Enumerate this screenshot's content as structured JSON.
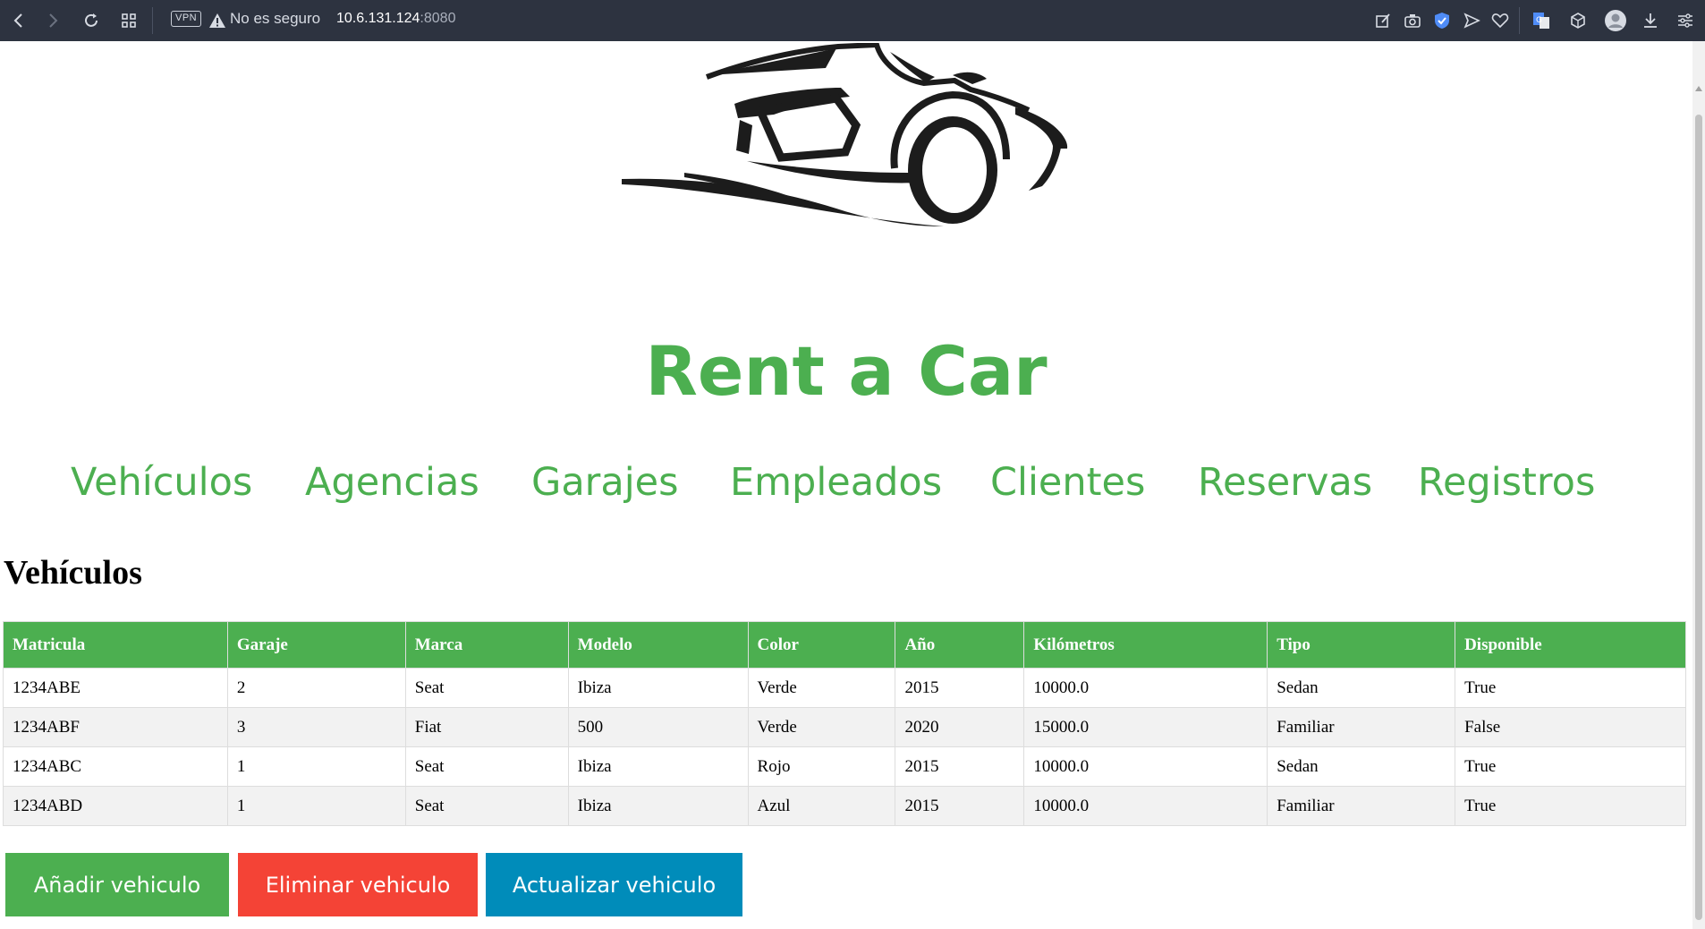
{
  "browser": {
    "vpn_label": "VPN",
    "security_text": "No es seguro",
    "url_host": "10.6.131.124",
    "url_port": ":8080"
  },
  "site": {
    "title": "Rent a Car"
  },
  "nav": {
    "items": [
      "Vehículos",
      "Agencias",
      "Garajes",
      "Empleados",
      "Clientes",
      "Reservas",
      "Registros"
    ]
  },
  "section": {
    "title": "Vehículos"
  },
  "table": {
    "headers": [
      "Matricula",
      "Garaje",
      "Marca",
      "Modelo",
      "Color",
      "Año",
      "Kilómetros",
      "Tipo",
      "Disponible"
    ],
    "rows": [
      [
        "1234ABE",
        "2",
        "Seat",
        "Ibiza",
        "Verde",
        "2015",
        "10000.0",
        "Sedan",
        "True"
      ],
      [
        "1234ABF",
        "3",
        "Fiat",
        "500",
        "Verde",
        "2020",
        "15000.0",
        "Familiar",
        "False"
      ],
      [
        "1234ABC",
        "1",
        "Seat",
        "Ibiza",
        "Rojo",
        "2015",
        "10000.0",
        "Sedan",
        "True"
      ],
      [
        "1234ABD",
        "1",
        "Seat",
        "Ibiza",
        "Azul",
        "2015",
        "10000.0",
        "Familiar",
        "True"
      ]
    ]
  },
  "actions": {
    "add_label": "Añadir vehiculo",
    "delete_label": "Eliminar vehiculo",
    "update_label": "Actualizar vehiculo"
  },
  "colors": {
    "accent_green": "#4caf50",
    "delete_red": "#f44336",
    "update_blue": "#008cba",
    "chrome_bg": "#2d3340"
  }
}
